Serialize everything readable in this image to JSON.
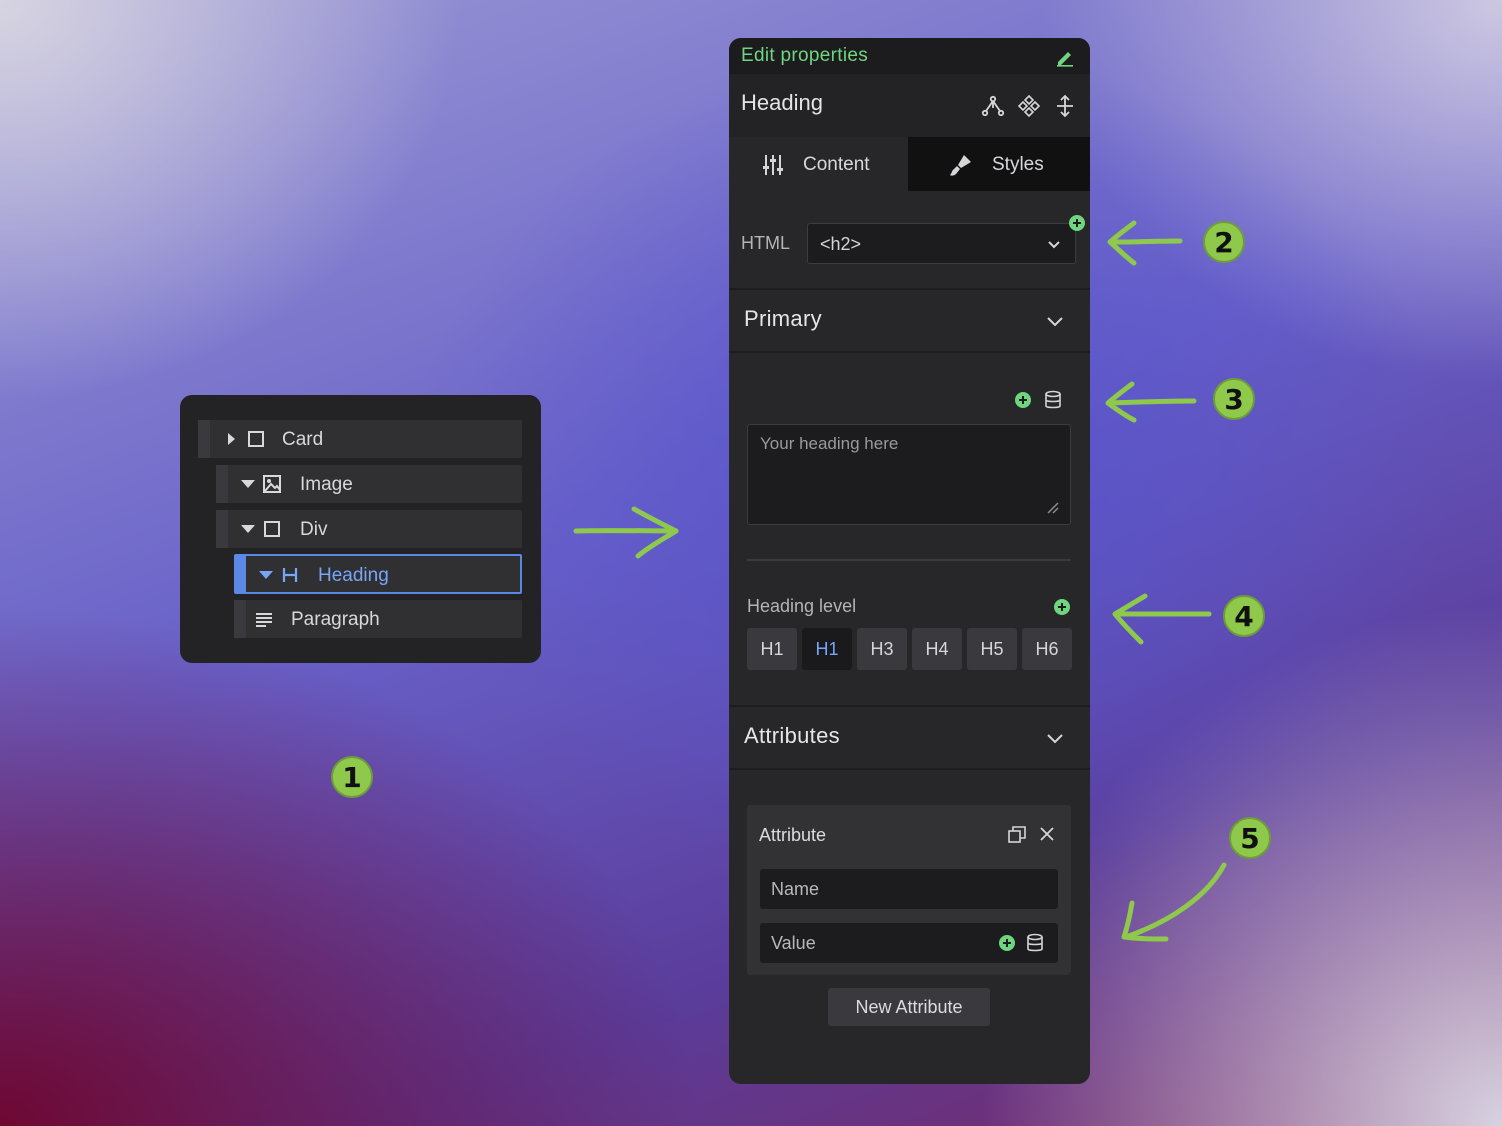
{
  "navigator": {
    "items": [
      {
        "label": "Card",
        "icon": "square-icon",
        "toggle": "collapsed"
      },
      {
        "label": "Image",
        "icon": "image-icon",
        "toggle": "expanded"
      },
      {
        "label": "Div",
        "icon": "square-icon",
        "toggle": "expanded"
      },
      {
        "label": "Heading",
        "icon": "heading-icon",
        "toggle": "expanded",
        "selected": true
      },
      {
        "label": "Paragraph",
        "icon": "paragraph-icon"
      }
    ]
  },
  "props": {
    "title": "Edit properties",
    "element_name": "Heading",
    "tabs": [
      {
        "label": "Content",
        "icon": "sliders-icon",
        "active": true
      },
      {
        "label": "Styles",
        "icon": "brush-icon"
      }
    ],
    "html": {
      "label": "HTML",
      "value": "<h2>"
    },
    "primary": {
      "title": "Primary",
      "placeholder": "Your heading here",
      "heading_level": {
        "label": "Heading level",
        "options": [
          "H1",
          "H1",
          "H3",
          "H4",
          "H5",
          "H6"
        ],
        "active_index": 1
      }
    },
    "attributes": {
      "title": "Attributes",
      "card_title": "Attribute",
      "name_placeholder": "Name",
      "value_placeholder": "Value",
      "new_button": "New Attribute"
    }
  },
  "annotations": {
    "badges": [
      "1",
      "2",
      "3",
      "4",
      "5"
    ],
    "accent_color": "#8ec94c"
  },
  "colors": {
    "panel": "#27272a",
    "highlight_green": "#6fd67f",
    "selection_blue": "#5b88e6"
  }
}
